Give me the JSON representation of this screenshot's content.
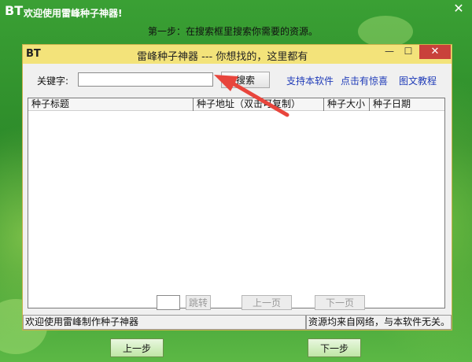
{
  "outer": {
    "logo": "BT",
    "title": "欢迎使用雷峰种子神器!",
    "close_glyph": "✕",
    "step_text": "第一步：在搜索框里搜索你需要的资源。",
    "prev_button": "上一步",
    "next_button": "下一步"
  },
  "window": {
    "logo": "BT",
    "title": "雷峰种子神器 --- 你想找的，这里都有",
    "minimize_glyph": "—",
    "maximize_glyph": "☐",
    "close_glyph": "✕"
  },
  "search": {
    "label": "关键字:",
    "value": "",
    "button": "搜索"
  },
  "links": [
    "支持本软件",
    "点击有惊喜",
    "图文教程"
  ],
  "table": {
    "columns": [
      "种子标题",
      "种子地址（双击可复制）",
      "种子大小",
      "种子日期"
    ],
    "rows": []
  },
  "pager": {
    "page_value": "",
    "jump_button": "跳转",
    "prev_button": "上一页",
    "next_button": "下一页"
  },
  "status": {
    "left": "欢迎使用雷峰制作种子神器",
    "right": "资源均来自网络，与本软件无关。"
  },
  "colors": {
    "outer_green": "#2f8a2a",
    "inner_titlebar": "#f3e37a",
    "link": "#1f3bb8",
    "close_red": "#c9413b",
    "arrow": "#e8453c"
  }
}
